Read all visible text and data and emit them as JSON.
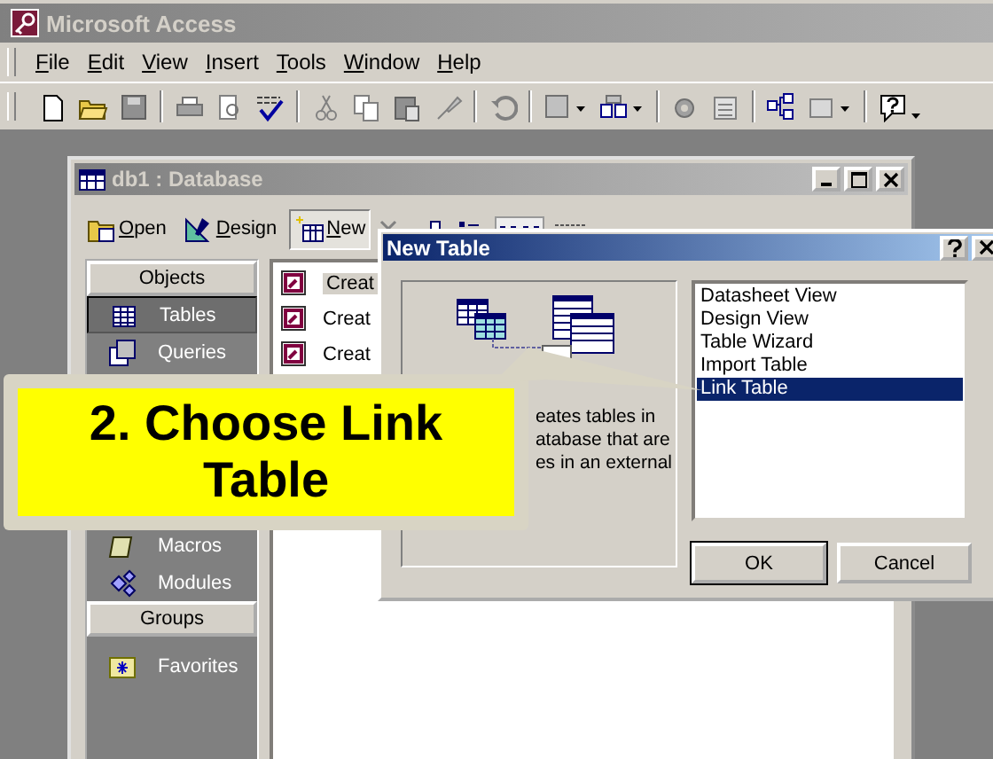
{
  "app": {
    "title": "Microsoft Access"
  },
  "menu": [
    "File",
    "Edit",
    "View",
    "Insert",
    "Tools",
    "Window",
    "Help"
  ],
  "database_window": {
    "title": "db1 : Database",
    "toolbar": [
      {
        "label": "Open",
        "pressed": false
      },
      {
        "label": "Design",
        "pressed": false
      },
      {
        "label": "New",
        "pressed": true
      }
    ],
    "objects_header": "Objects",
    "objects": [
      {
        "label": "Tables",
        "selected": true
      },
      {
        "label": "Queries",
        "selected": false
      },
      {
        "label": "Macros",
        "selected": false
      },
      {
        "label": "Modules",
        "selected": false
      }
    ],
    "groups_header": "Groups",
    "groups": [
      "Favorites"
    ],
    "items": [
      "Creat",
      "Creat",
      "Creat"
    ]
  },
  "dialog": {
    "title": "New Table",
    "description_lines": [
      "eates tables in",
      "atabase that are",
      "es in an external"
    ],
    "types": [
      {
        "label": "Datasheet View",
        "selected": false
      },
      {
        "label": "Design View",
        "selected": false
      },
      {
        "label": "Table Wizard",
        "selected": false
      },
      {
        "label": "Import Table",
        "selected": false
      },
      {
        "label": "Link Table",
        "selected": true
      }
    ],
    "buttons": [
      "OK",
      "Cancel"
    ]
  },
  "callout": {
    "text": "2. Choose Link Table"
  }
}
